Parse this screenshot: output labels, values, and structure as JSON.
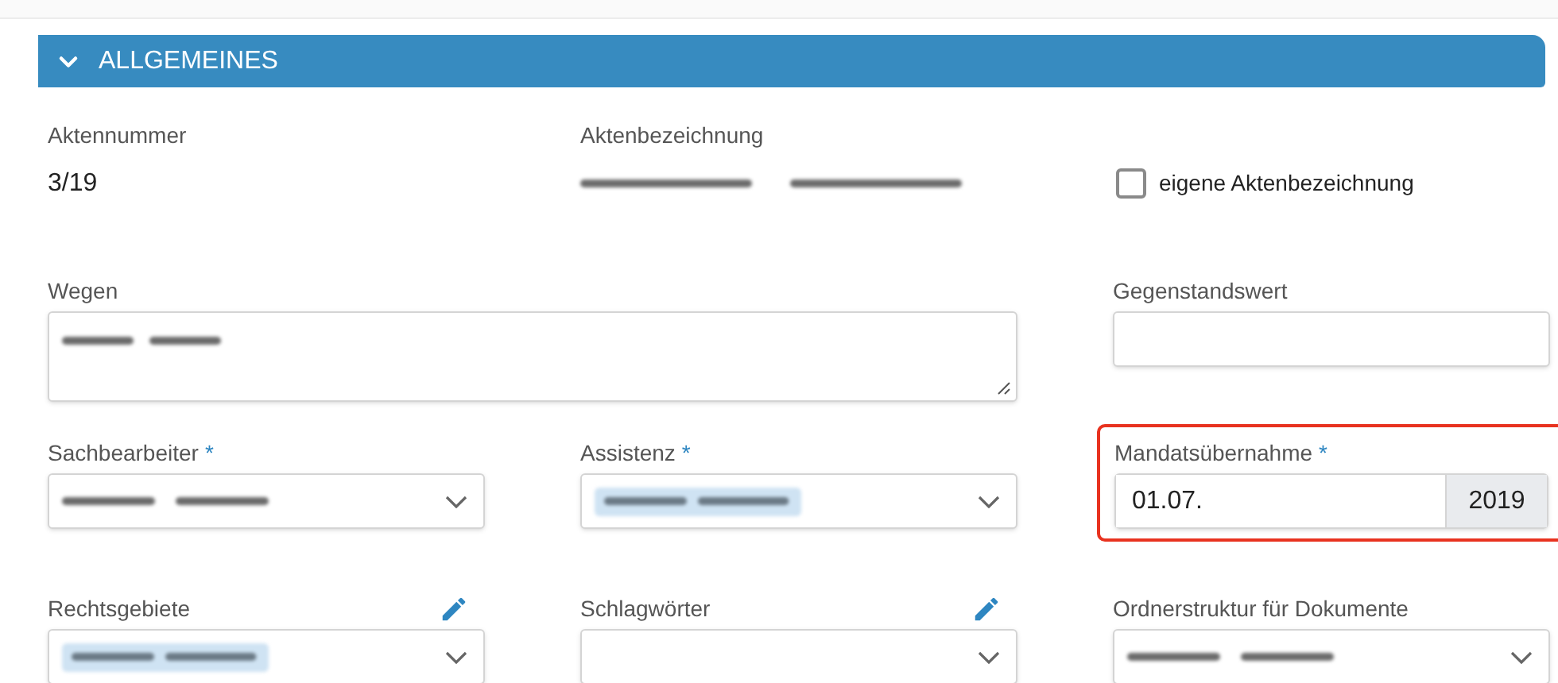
{
  "section": {
    "title": "ALLGEMEINES",
    "expanded": true
  },
  "rows": [
    [
      {
        "kind": "static",
        "label": "Aktennummer",
        "value": "3/19"
      },
      {
        "kind": "static",
        "label": "Aktenbezeichnung",
        "blurred": true
      },
      {
        "kind": "checkbox",
        "text": "eigene Aktenbezeichnung",
        "checked": false
      }
    ],
    [
      {
        "kind": "textarea",
        "label": "Wegen",
        "blurred": true
      },
      {
        "kind": "input",
        "label": "Gegenstandswert"
      }
    ],
    [
      {
        "kind": "select",
        "label": "Sachbearbeiter",
        "required_mark": "*",
        "blurred": true
      },
      {
        "kind": "select",
        "label": "Assistenz",
        "required_mark": "*",
        "blurred": true,
        "tinted": true
      },
      {
        "kind": "date",
        "label": "Mandatsübernahme",
        "required_mark": "*",
        "value": "01.07.",
        "year": "2019",
        "highlighted": true
      }
    ],
    [
      {
        "kind": "select",
        "label": "Rechtsgebiete",
        "editable": true,
        "blurred": true,
        "tinted": true
      },
      {
        "kind": "select",
        "label": "Schlagwörter",
        "editable": true
      },
      {
        "kind": "select",
        "label": "Ordnerstruktur für Dokumente",
        "blurred": true
      }
    ]
  ]
}
